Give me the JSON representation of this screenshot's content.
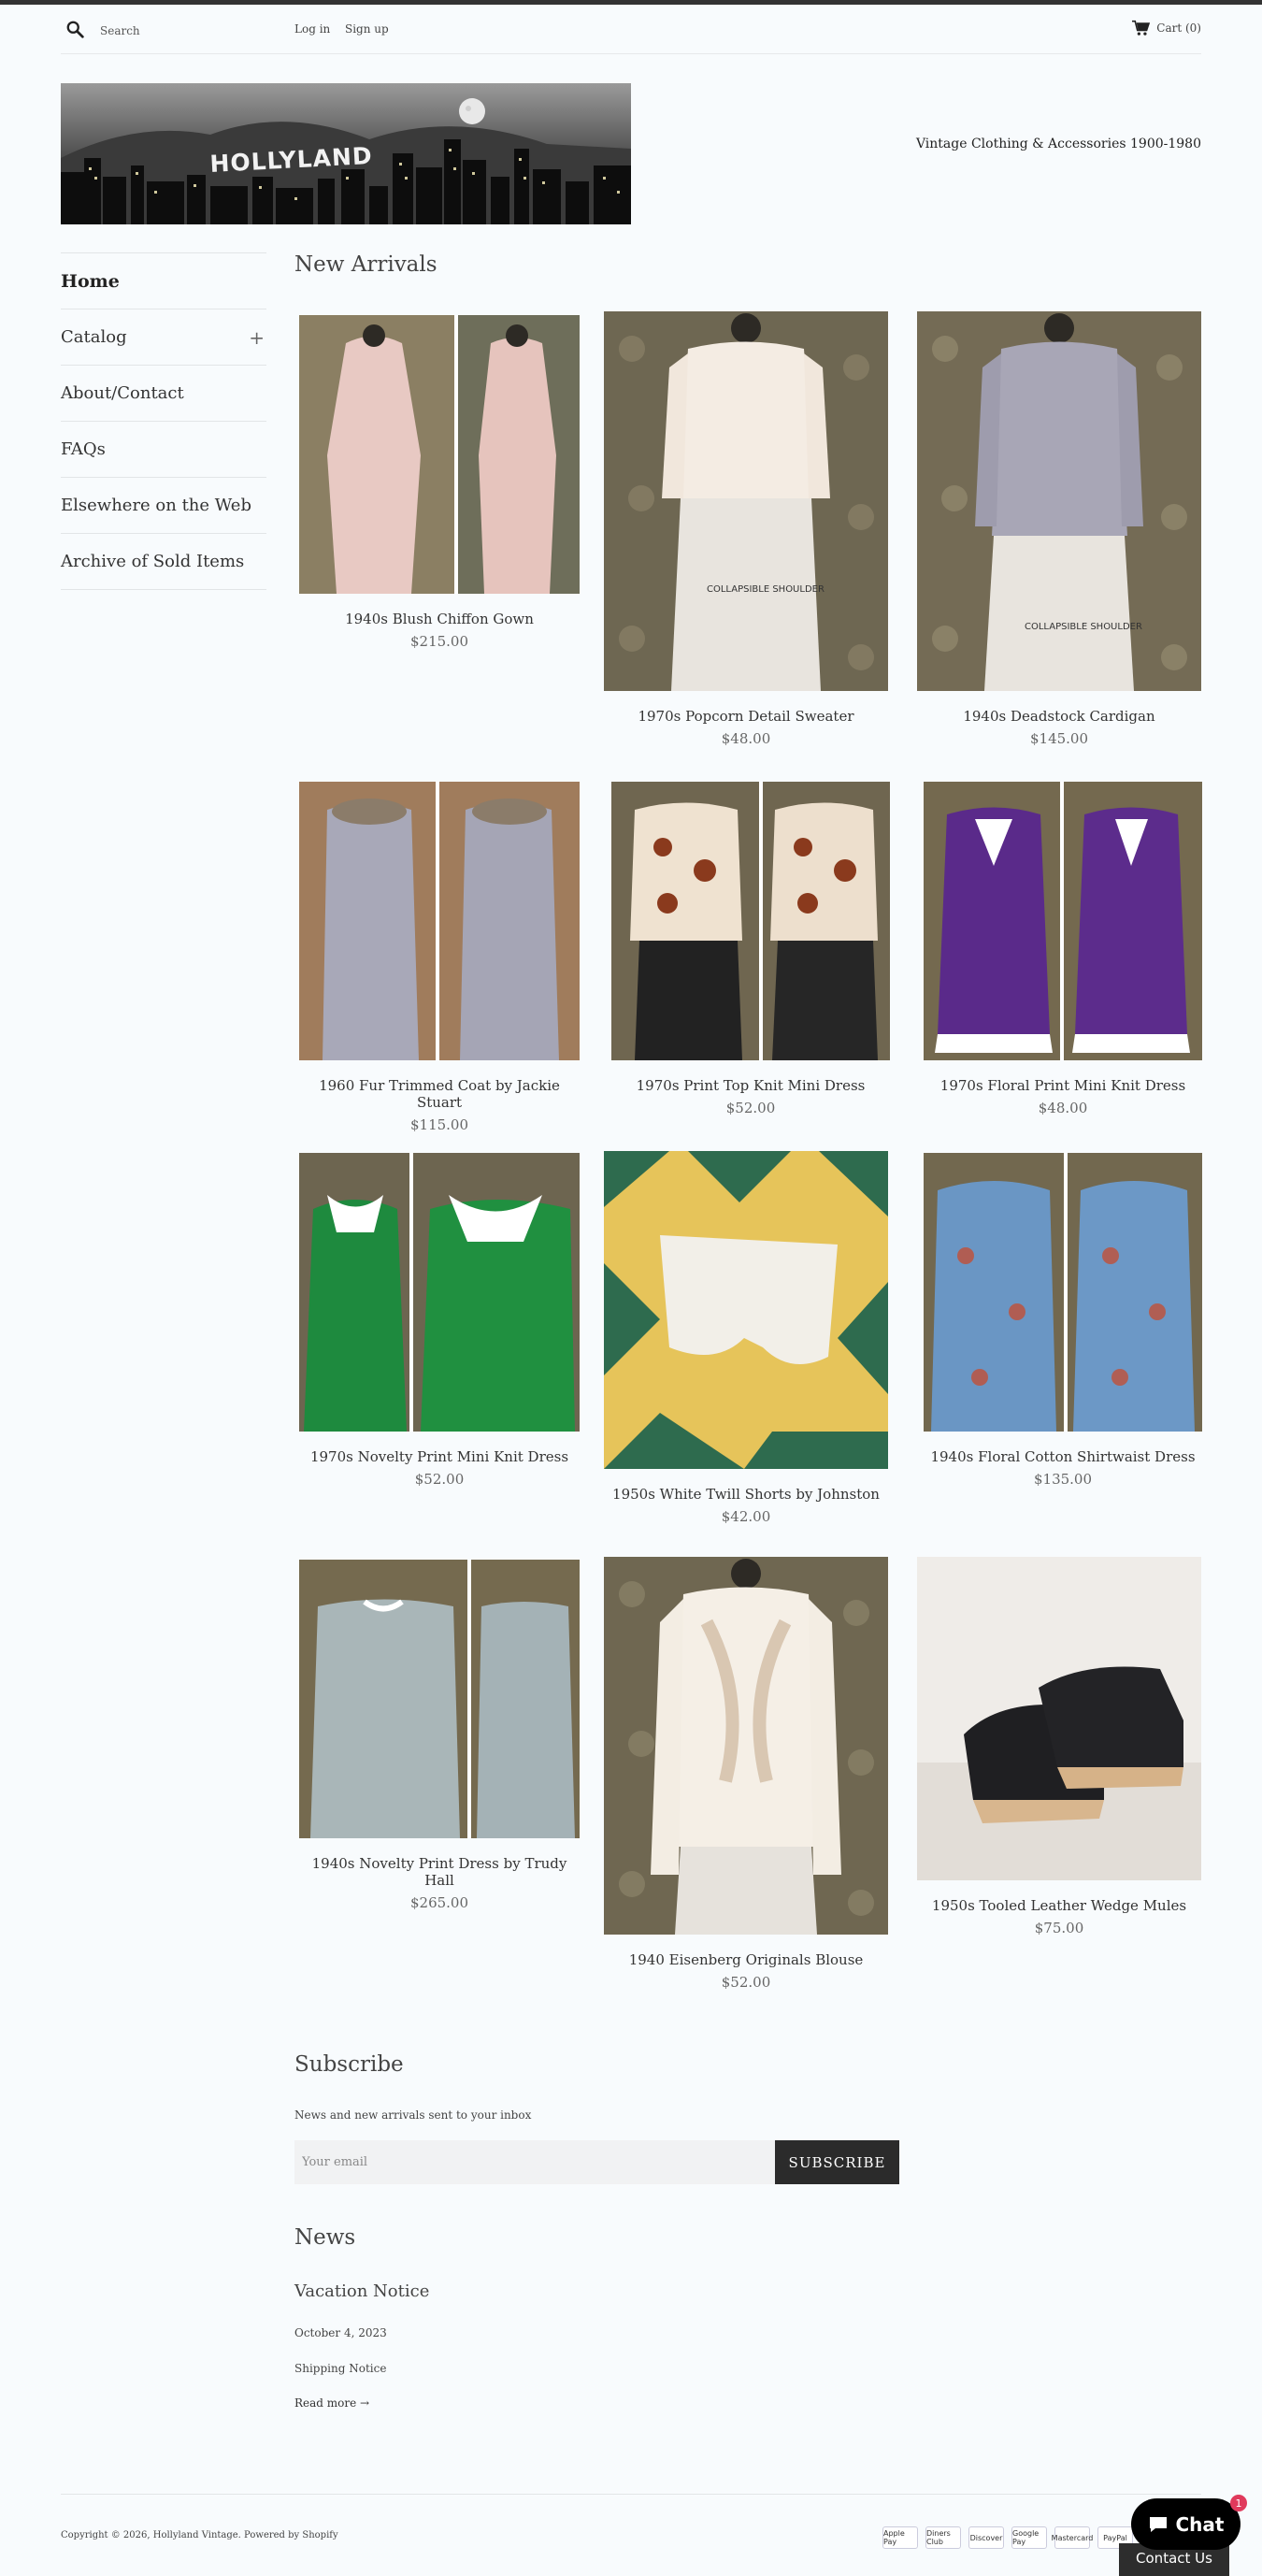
{
  "header": {
    "search_placeholder": "Search",
    "login_label": "Log in",
    "signup_label": "Sign up",
    "cart_label": "Cart (0)"
  },
  "logo": {
    "text": "HOLLYLAND"
  },
  "tagline": "Vintage Clothing & Accessories 1900-1980",
  "sidebar": {
    "items": [
      {
        "label": "Home",
        "active": true
      },
      {
        "label": "Catalog",
        "expandable": true,
        "toggle": "+"
      },
      {
        "label": "About/Contact"
      },
      {
        "label": "FAQs"
      },
      {
        "label": "Elsewhere on the Web"
      },
      {
        "label": "Archive of Sold Items"
      }
    ]
  },
  "main": {
    "title": "New Arrivals",
    "products": [
      {
        "name": "1940s Blush Chiffon Gown",
        "price": "$215.00",
        "image": "two-view-pink-gown"
      },
      {
        "name": "1970s Popcorn Detail Sweater",
        "price": "$48.00",
        "image": "cream-sweater-on-form"
      },
      {
        "name": "1940s Deadstock Cardigan",
        "price": "$145.00",
        "image": "lavender-cardigan-on-form"
      },
      {
        "name": "1960 Fur Trimmed Coat by Jackie Stuart",
        "price": "$115.00",
        "image": "two-view-grey-coat"
      },
      {
        "name": "1970s Print Top Knit Mini Dress",
        "price": "$52.00",
        "image": "two-view-print-dress"
      },
      {
        "name": "1970s Floral Print Mini Knit Dress",
        "price": "$48.00",
        "image": "two-view-purple-dress"
      },
      {
        "name": "1970s Novelty Print Mini Knit Dress",
        "price": "$52.00",
        "image": "two-view-green-dress"
      },
      {
        "name": "1950s White Twill Shorts by Johnston",
        "price": "$42.00",
        "image": "white-shorts-on-checker"
      },
      {
        "name": "1940s Floral Cotton Shirtwaist Dress",
        "price": "$135.00",
        "image": "two-view-blue-floral-dress"
      },
      {
        "name": "1940s Novelty Print Dress by Trudy Hall",
        "price": "$265.00",
        "image": "two-view-grey-print-dress"
      },
      {
        "name": "1940 Eisenberg Originals Blouse",
        "price": "$52.00",
        "image": "sheer-blouse-on-form"
      },
      {
        "name": "1950s Tooled Leather Wedge Mules",
        "price": "$75.00",
        "image": "black-leather-mules"
      }
    ]
  },
  "subscribe": {
    "title": "Subscribe",
    "subtitle": "News and new arrivals sent to your inbox",
    "email_placeholder": "Your email",
    "button_label": "SUBSCRIBE"
  },
  "news": {
    "title": "News",
    "post_title": "Vacation Notice",
    "post_date": "October 4, 2023",
    "post_excerpt": "Shipping Notice",
    "read_more": "Read more →"
  },
  "footer": {
    "copyright": "Copyright © 2026, Hollyland Vintage. Powered by Shopify",
    "payments": [
      "Apple Pay",
      "Diners Club",
      "Discover",
      "Google Pay",
      "Mastercard",
      "PayPal"
    ]
  },
  "chat": {
    "label": "Chat",
    "badge": "1",
    "contact": "Contact Us"
  },
  "colors": {
    "accent": "#2b2b2b",
    "background": "#f8fbfd",
    "badge": "#e03a5c"
  }
}
